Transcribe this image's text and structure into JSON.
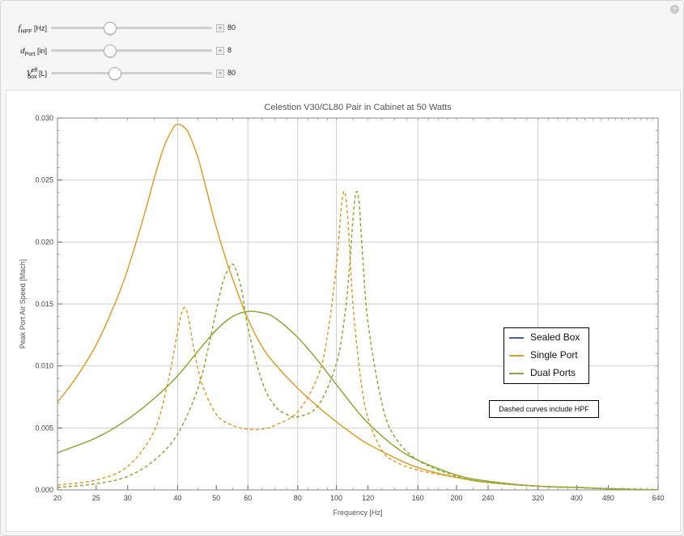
{
  "controls": [
    {
      "name_main": "f",
      "name_sub": "HPF",
      "name_sup": "",
      "unit": "[Hz]",
      "value": "80",
      "fraction": 0.36
    },
    {
      "name_main": "d",
      "name_sub": "Port",
      "name_sup": "",
      "unit": "[in]",
      "value": "8",
      "fraction": 0.36
    },
    {
      "name_main": "V",
      "name_sub": "box",
      "name_sup": "eff",
      "unit": "[L]",
      "value": "80",
      "fraction": 0.39
    }
  ],
  "legend": [
    {
      "label": "Sealed Box",
      "color": "#4b5fa6"
    },
    {
      "label": "Single Port",
      "color": "#e09d26"
    },
    {
      "label": "Dual Ports",
      "color": "#8bab35"
    }
  ],
  "note": "Dashed curves include HPF",
  "chart_data": {
    "type": "line",
    "title": "Celestion V30/CL80 Pair in Cabinet at 50 Watts",
    "xlabel": "Frequency [Hz]",
    "ylabel": "Peak Port Air Speed [Mach]",
    "xscale": "log",
    "xlim": [
      20,
      640
    ],
    "ylim": [
      0,
      0.03
    ],
    "x_ticks": [
      "20",
      "25",
      "30",
      "40",
      "50",
      "60",
      "80",
      "100",
      "120",
      "160",
      "200",
      "240",
      "320",
      "400",
      "480",
      "640"
    ],
    "x_tick_values": [
      20,
      25,
      30,
      40,
      50,
      60,
      80,
      100,
      120,
      160,
      200,
      240,
      320,
      400,
      480,
      640
    ],
    "y_ticks": [
      "0.000",
      "0.005",
      "0.010",
      "0.015",
      "0.020",
      "0.025",
      "0.030"
    ],
    "y_tick_values": [
      0,
      0.005,
      0.01,
      0.015,
      0.02,
      0.025,
      0.03
    ],
    "grid_x": [
      40,
      60,
      80,
      100,
      160,
      320
    ],
    "grid_y": [
      0.005,
      0.01,
      0.015,
      0.02,
      0.025
    ],
    "legend_position": "center-right",
    "series": [
      {
        "name": "Sealed Box",
        "color": "#4b5fa6",
        "dashed": false,
        "x": [],
        "y": []
      },
      {
        "name": "Single Port",
        "color": "#e09d26",
        "dashed": false,
        "x": [
          20,
          22,
          25,
          28,
          30,
          33,
          35,
          37,
          39,
          40,
          41,
          42,
          43,
          45,
          47,
          50,
          53,
          56,
          60,
          65,
          70,
          80,
          90,
          100,
          110,
          120,
          140,
          160,
          200,
          240,
          320,
          400,
          480,
          640
        ],
        "y": [
          0.0071,
          0.0088,
          0.0117,
          0.0152,
          0.0178,
          0.0222,
          0.0252,
          0.0277,
          0.0292,
          0.0295,
          0.0294,
          0.0291,
          0.0285,
          0.0268,
          0.0245,
          0.0212,
          0.0185,
          0.0163,
          0.0138,
          0.0116,
          0.0102,
          0.0082,
          0.0067,
          0.0055,
          0.0045,
          0.0037,
          0.0026,
          0.0018,
          0.001,
          0.0006,
          0.0003,
          0.0002,
          0.0001,
          0.0
        ]
      },
      {
        "name": "Dual Ports",
        "color": "#8bab35",
        "dashed": false,
        "x": [
          20,
          25,
          30,
          35,
          40,
          45,
          50,
          55,
          60,
          65,
          70,
          80,
          90,
          100,
          110,
          120,
          140,
          160,
          200,
          240,
          320,
          400,
          480,
          640
        ],
        "y": [
          0.003,
          0.0042,
          0.0057,
          0.0074,
          0.0092,
          0.0112,
          0.0129,
          0.014,
          0.0144,
          0.0143,
          0.0139,
          0.0123,
          0.0104,
          0.0085,
          0.0068,
          0.0054,
          0.0035,
          0.0024,
          0.0012,
          0.0007,
          0.0003,
          0.0002,
          0.0001,
          0.0
        ]
      },
      {
        "name": "Single Port (HPF)",
        "color": "#e09d26",
        "dashed": true,
        "x": [
          20,
          25,
          30,
          35,
          38,
          40,
          41,
          41.7,
          42.5,
          44,
          46,
          50,
          55,
          60,
          65,
          70,
          80,
          90,
          95,
          100,
          103,
          105,
          107,
          110,
          115,
          120,
          130,
          140,
          160,
          200,
          240,
          320,
          400,
          480,
          640
        ],
        "y": [
          0.0004,
          0.0008,
          0.0019,
          0.0048,
          0.009,
          0.0128,
          0.0143,
          0.0147,
          0.014,
          0.0113,
          0.0086,
          0.0061,
          0.0052,
          0.0049,
          0.0049,
          0.0052,
          0.0063,
          0.0092,
          0.0125,
          0.0181,
          0.023,
          0.024,
          0.0215,
          0.015,
          0.009,
          0.0058,
          0.0032,
          0.0023,
          0.0016,
          0.001,
          0.0006,
          0.0003,
          0.0002,
          0.0001,
          0.0
        ]
      },
      {
        "name": "Dual Ports (HPF)",
        "color": "#8bab35",
        "dashed": true,
        "x": [
          20,
          25,
          30,
          35,
          40,
          45,
          48,
          50,
          52,
          54,
          55,
          56,
          58,
          60,
          65,
          70,
          75,
          80,
          90,
          100,
          105,
          108,
          110,
          112,
          114,
          116,
          120,
          130,
          140,
          160,
          200,
          240,
          320,
          400,
          480,
          640
        ],
        "y": [
          0.0002,
          0.0005,
          0.0011,
          0.0024,
          0.0045,
          0.0082,
          0.0118,
          0.0145,
          0.0168,
          0.018,
          0.0182,
          0.0178,
          0.016,
          0.0131,
          0.0088,
          0.0068,
          0.0061,
          0.0059,
          0.0068,
          0.0102,
          0.0141,
          0.0182,
          0.0218,
          0.024,
          0.0232,
          0.0195,
          0.0135,
          0.007,
          0.0043,
          0.0024,
          0.0011,
          0.0006,
          0.0003,
          0.0002,
          0.0001,
          0.0
        ]
      }
    ]
  }
}
